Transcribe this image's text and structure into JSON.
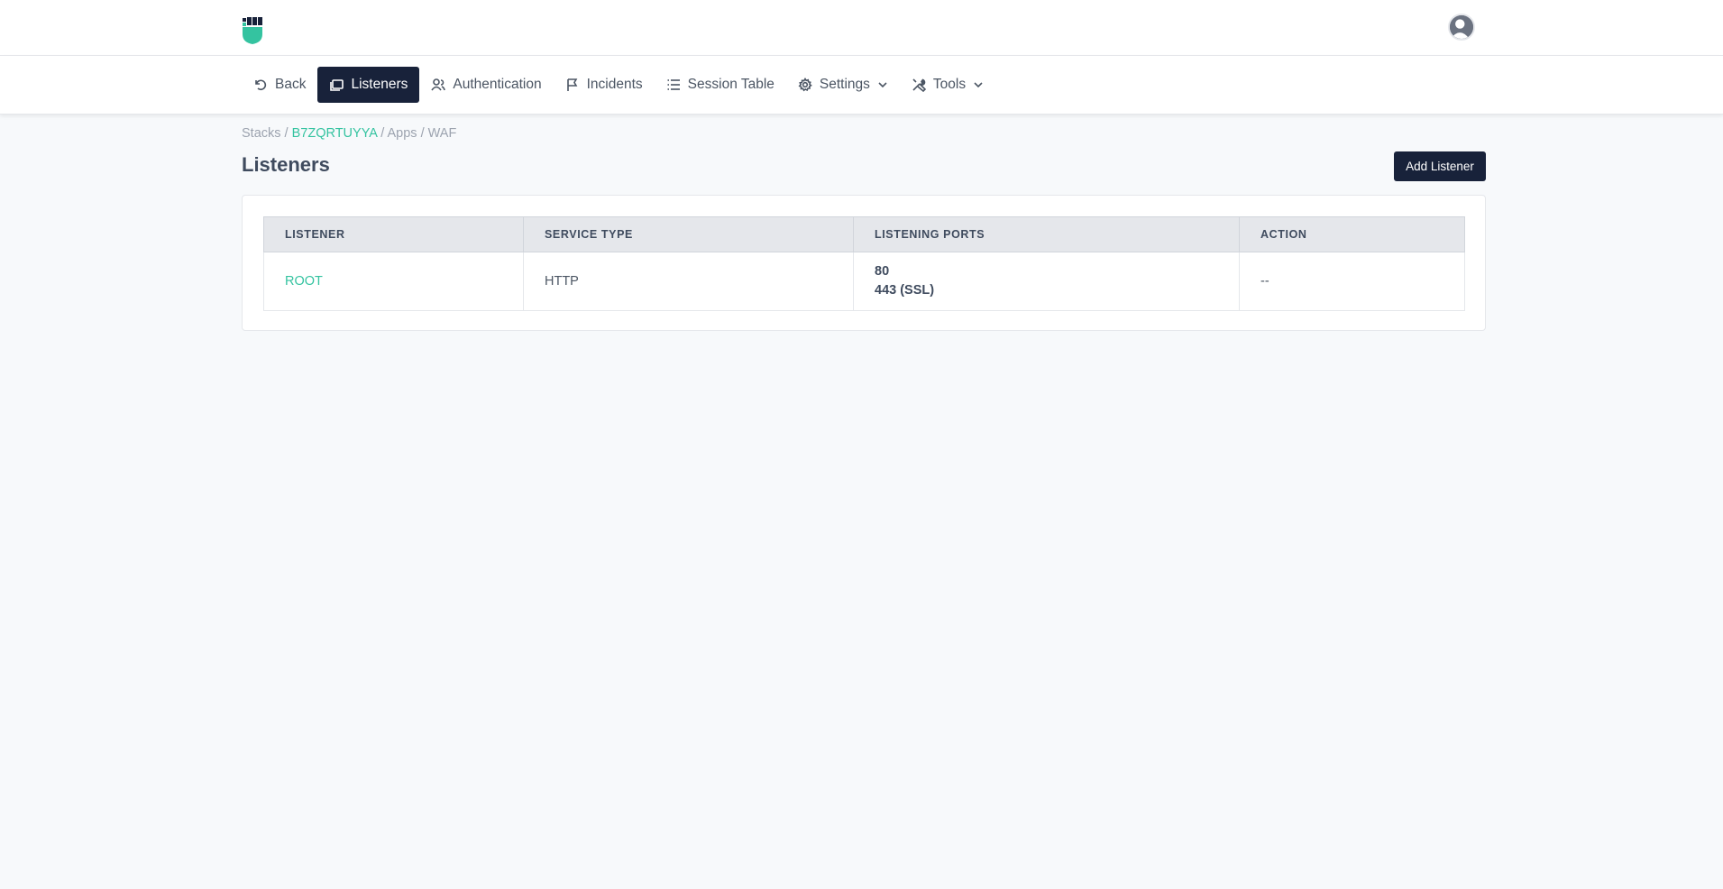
{
  "header": {
    "logo_icon": "fist-shield-logo",
    "avatar_icon": "user-avatar-icon"
  },
  "nav": {
    "items": [
      {
        "label": "Back",
        "icon": "undo-icon"
      },
      {
        "label": "Listeners",
        "icon": "window-stack-icon",
        "active": true
      },
      {
        "label": "Authentication",
        "icon": "users-icon"
      },
      {
        "label": "Incidents",
        "icon": "flag-icon"
      },
      {
        "label": "Session Table",
        "icon": "list-icon"
      },
      {
        "label": "Settings",
        "icon": "gear-icon",
        "dropdown": true
      },
      {
        "label": "Tools",
        "icon": "tools-icon",
        "dropdown": true
      }
    ]
  },
  "breadcrumb": {
    "stacks": "Stacks",
    "stack_id": "B7ZQRTUYYA",
    "apps": "Apps",
    "waf": "WAF",
    "separator": "/"
  },
  "page": {
    "title": "Listeners",
    "add_button": "Add Listener"
  },
  "table": {
    "headers": [
      "LISTENER",
      "SERVICE TYPE",
      "LISTENING PORTS",
      "ACTION"
    ],
    "rows": [
      {
        "listener": "ROOT",
        "service_type": "HTTP",
        "ports": [
          "80",
          "443 (SSL)"
        ],
        "action": "--"
      }
    ]
  },
  "colors": {
    "accent": "#34c3a0",
    "dark": "#18223a",
    "background": "#f7f9fb"
  }
}
